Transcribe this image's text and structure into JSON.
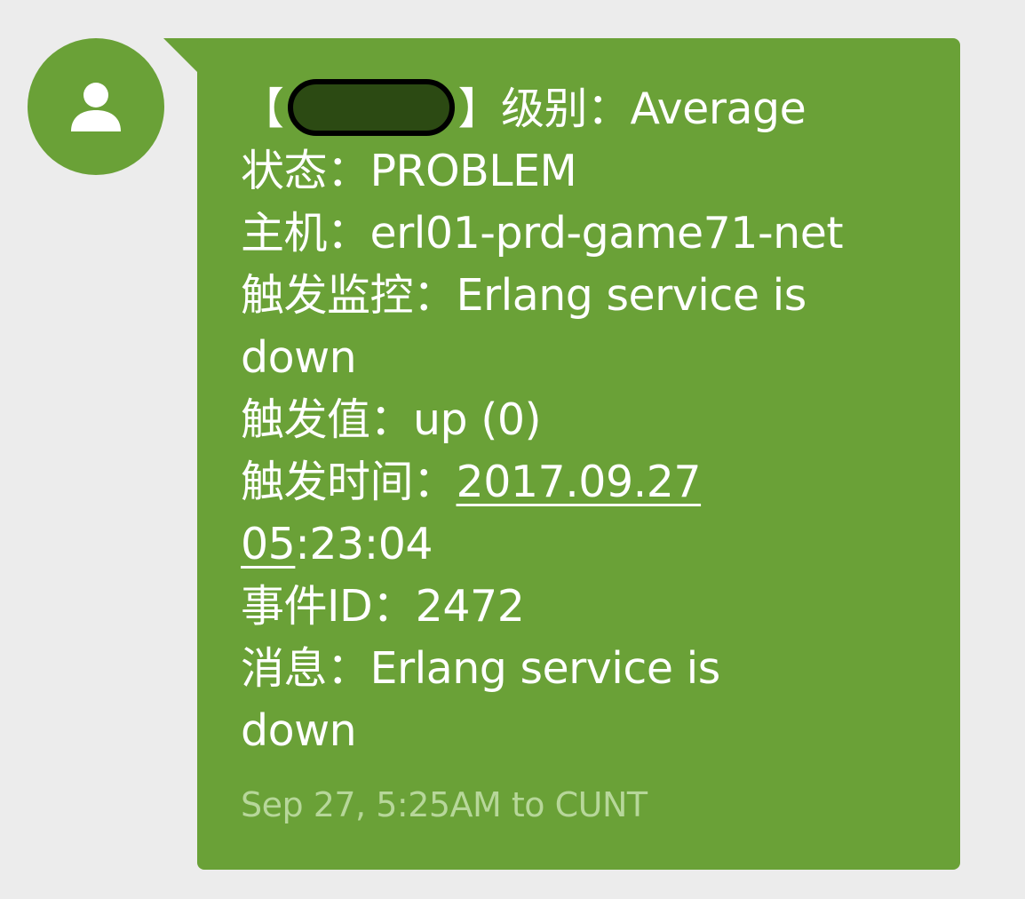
{
  "colors": {
    "accent": "#6aa137",
    "page_bg": "#ececec",
    "text": "#ffffff",
    "meta_text": "#b7d79a"
  },
  "sender": {
    "avatar_icon": "person-icon"
  },
  "message": {
    "line1_open_bracket": "【",
    "line1_close_bracket": "】",
    "line1_rest": "级别：Average",
    "status_line": "状态：PROBLEM",
    "host_line": "主机：erl01-prd-game71-net",
    "trigger_monitor_line1": "触发监控：Erlang service is",
    "trigger_monitor_line2": "down",
    "trigger_value_line": "触发值：up (0)",
    "trigger_time_label": "触发时间：",
    "trigger_time_date": "2017.09.27",
    "trigger_time_hour": "05",
    "trigger_time_rest": ":23:04",
    "event_id_line": "事件ID：2472",
    "msg_line1": "消息：Erlang service  is",
    "msg_line2": "down"
  },
  "meta": {
    "timestamp_recipient": "Sep 27, 5:25AM to CUNT"
  }
}
